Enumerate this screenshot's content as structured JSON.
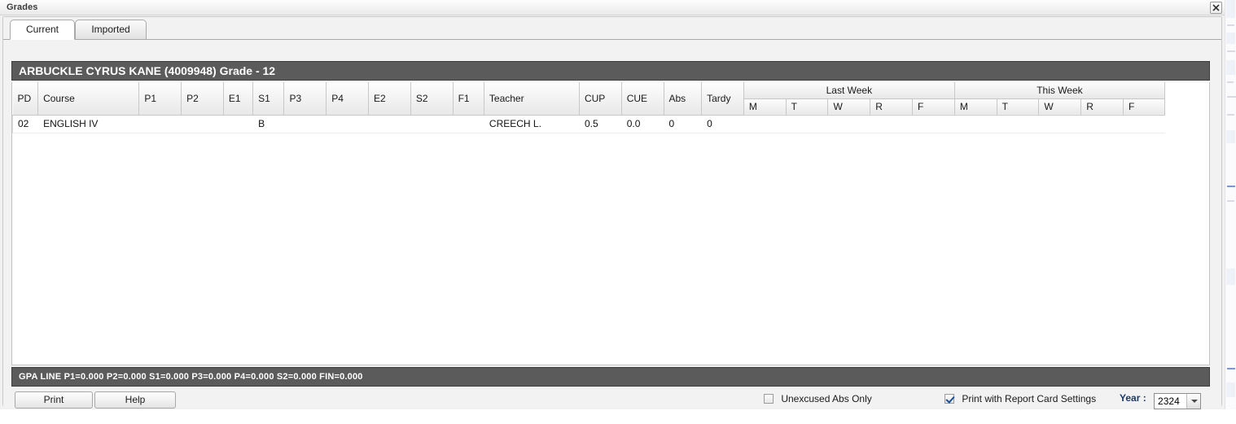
{
  "window": {
    "title": "Grades",
    "close_icon": "close-icon"
  },
  "tabs": [
    {
      "label": "Current",
      "active": true
    },
    {
      "label": "Imported",
      "active": false
    }
  ],
  "student": {
    "header": "ARBUCKLE CYRUS KANE (4009948) Grade - 12"
  },
  "grid": {
    "group_headers": {
      "last_week": "Last Week",
      "this_week": "This Week"
    },
    "columns": [
      "PD",
      "Course",
      "P1",
      "P2",
      "E1",
      "S1",
      "P3",
      "P4",
      "E2",
      "S2",
      "F1",
      "Teacher",
      "CUP",
      "CUE",
      "Abs",
      "Tardy"
    ],
    "day_columns_last_week": [
      "M",
      "T",
      "W",
      "R",
      "F"
    ],
    "day_columns_this_week": [
      "M",
      "T",
      "W",
      "R",
      "F"
    ],
    "rows": [
      {
        "pd": "02",
        "course": "ENGLISH IV",
        "p1": "",
        "p2": "",
        "e1": "",
        "s1": "B",
        "p3": "",
        "p4": "",
        "e2": "",
        "s2": "",
        "f1": "",
        "teacher": "CREECH L.",
        "cup": "0.5",
        "cue": "0.0",
        "abs": "0",
        "tardy": "0",
        "lw_m": "",
        "lw_t": "",
        "lw_w": "",
        "lw_r": "",
        "lw_f": "",
        "tw_m": "",
        "tw_t": "",
        "tw_w": "",
        "tw_r": "",
        "tw_f": ""
      }
    ]
  },
  "gpa_line": "GPA LINE P1=0.000  P2=0.000  S1=0.000  P3=0.000  P4=0.000  S2=0.000  FIN=0.000",
  "toolbar": {
    "print_label": "Print",
    "help_label": "Help",
    "unexcused_label": "Unexcused Abs Only",
    "unexcused_checked": false,
    "reportcard_label": "Print with Report Card Settings",
    "reportcard_checked": true,
    "year_label": "Year :",
    "year_value": "2324"
  },
  "colors": {
    "header_bar": "#5b5b5b",
    "accent_label": "#1b3a6b",
    "checkmark": "#1d4f91",
    "window_bg": "#f2f2f2"
  }
}
